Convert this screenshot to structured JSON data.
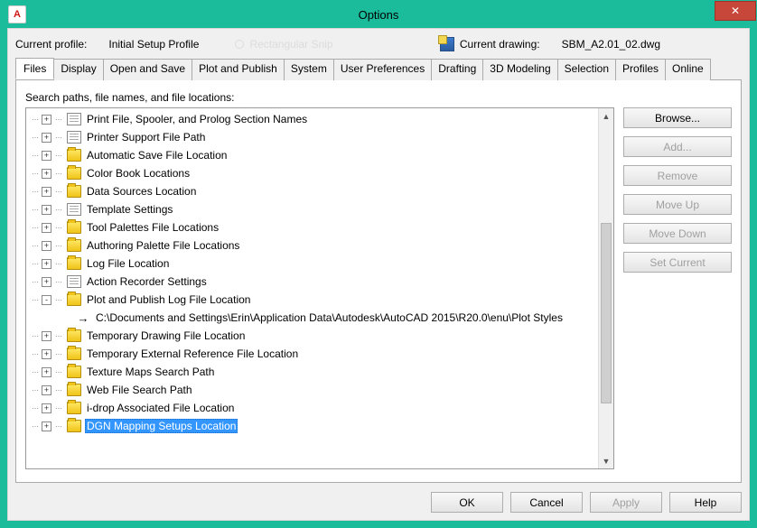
{
  "window": {
    "title": "Options",
    "close_glyph": "✕",
    "app_glyph": "A"
  },
  "header": {
    "profile_label": "Current profile:",
    "profile_name": "Initial Setup Profile",
    "snip_text": "Rectangular Snip",
    "drawing_label": "Current drawing:",
    "drawing_name": "SBM_A2.01_02.dwg"
  },
  "tabs": [
    "Files",
    "Display",
    "Open and Save",
    "Plot and Publish",
    "System",
    "User Preferences",
    "Drafting",
    "3D Modeling",
    "Selection",
    "Profiles",
    "Online"
  ],
  "active_tab_index": 0,
  "panel": {
    "search_label": "Search paths, file names, and file locations:"
  },
  "tree": [
    {
      "toggle": "+",
      "icon": "doc",
      "label": "Print File, Spooler, and Prolog Section Names"
    },
    {
      "toggle": "+",
      "icon": "doc",
      "label": "Printer Support File Path"
    },
    {
      "toggle": "+",
      "icon": "folder",
      "label": "Automatic Save File Location"
    },
    {
      "toggle": "+",
      "icon": "folder",
      "label": "Color Book Locations"
    },
    {
      "toggle": "+",
      "icon": "folder",
      "label": "Data Sources Location"
    },
    {
      "toggle": "+",
      "icon": "doc",
      "label": "Template Settings"
    },
    {
      "toggle": "+",
      "icon": "folder",
      "label": "Tool Palettes File Locations"
    },
    {
      "toggle": "+",
      "icon": "folder",
      "label": "Authoring Palette File Locations"
    },
    {
      "toggle": "+",
      "icon": "folder",
      "label": "Log File Location"
    },
    {
      "toggle": "+",
      "icon": "doc",
      "label": "Action Recorder Settings"
    },
    {
      "toggle": "-",
      "icon": "folder",
      "label": "Plot and Publish Log File Location",
      "expanded": true
    },
    {
      "toggle": " ",
      "icon": "arrow",
      "label": "C:\\Documents and Settings\\Erin\\Application Data\\Autodesk\\AutoCAD 2015\\R20.0\\enu\\Plot Styles",
      "child": true
    },
    {
      "toggle": "+",
      "icon": "folder",
      "label": "Temporary Drawing File Location"
    },
    {
      "toggle": "+",
      "icon": "folder",
      "label": "Temporary External Reference File Location"
    },
    {
      "toggle": "+",
      "icon": "folder",
      "label": "Texture Maps Search Path"
    },
    {
      "toggle": "+",
      "icon": "folder",
      "label": "Web File Search Path"
    },
    {
      "toggle": "+",
      "icon": "folder",
      "label": "i-drop Associated File Location"
    },
    {
      "toggle": "+",
      "icon": "folder",
      "label": "DGN Mapping Setups Location",
      "selected": true
    }
  ],
  "side_buttons": [
    {
      "label": "Browse...",
      "enabled": true
    },
    {
      "label": "Add...",
      "enabled": false
    },
    {
      "label": "Remove",
      "enabled": false
    },
    {
      "label": "Move Up",
      "enabled": false
    },
    {
      "label": "Move Down",
      "enabled": false
    },
    {
      "label": "Set Current",
      "enabled": false
    }
  ],
  "bottom_buttons": {
    "ok": "OK",
    "cancel": "Cancel",
    "apply": "Apply",
    "help": "Help"
  }
}
